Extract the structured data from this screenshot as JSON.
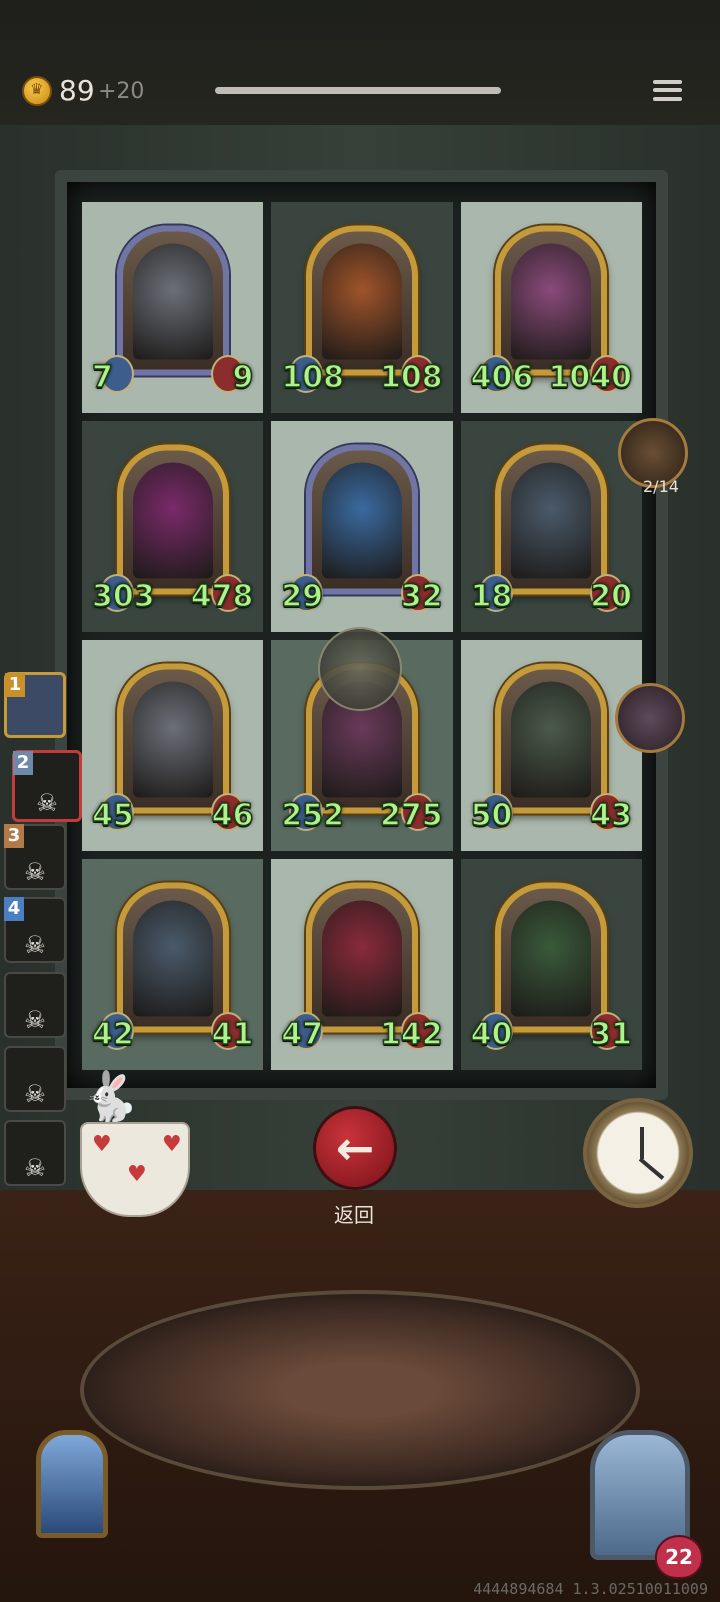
{
  "header": {
    "gold": "89",
    "gold_increment": "+20"
  },
  "board": {
    "rows": [
      [
        {
          "name": "gray-dragon",
          "atk": "7",
          "hp": "9",
          "style": "light",
          "frame": "blue",
          "color": "#6b6f78"
        },
        {
          "name": "orange-dragon",
          "atk": "108",
          "hp": "108",
          "style": "dark",
          "frame": "gold",
          "color": "#a0542a"
        },
        {
          "name": "monkey-king",
          "atk": "406",
          "hp": "1040",
          "style": "light",
          "frame": "gold",
          "color": "#8a4a7a"
        }
      ],
      [
        {
          "name": "red-haired-girl",
          "atk": "303",
          "hp": "478",
          "style": "dark",
          "frame": "gold",
          "color": "#7a2a6a"
        },
        {
          "name": "blue-elf",
          "atk": "29",
          "hp": "32",
          "style": "light",
          "frame": "blue",
          "color": "#3a6aa0"
        },
        {
          "name": "bat-beast",
          "atk": "18",
          "hp": "20",
          "style": "dark",
          "frame": "gold",
          "color": "#4a5a6a"
        }
      ],
      [
        {
          "name": "gray-dragon-2",
          "atk": "45",
          "hp": "46",
          "style": "light",
          "frame": "gold",
          "color": "#6b6f78"
        },
        {
          "name": "fire-rat",
          "atk": "252",
          "hp": "275",
          "style": "mid",
          "frame": "gold",
          "color": "#6a3a5a"
        },
        {
          "name": "hooded-reaper",
          "atk": "50",
          "hp": "43",
          "style": "light",
          "frame": "gold",
          "color": "#4a5a4a"
        }
      ],
      [
        {
          "name": "bat-beast-2",
          "atk": "42",
          "hp": "41",
          "style": "mid",
          "frame": "gold",
          "color": "#4a5a6a"
        },
        {
          "name": "clown",
          "atk": "47",
          "hp": "142",
          "style": "light",
          "frame": "gold",
          "color": "#8a2a3a"
        },
        {
          "name": "dragon-beast",
          "atk": "40",
          "hp": "31",
          "style": "dark",
          "frame": "gold",
          "color": "#3a5a3a"
        }
      ]
    ]
  },
  "side": {
    "turn_counter": "2/14"
  },
  "queue": {
    "items": [
      {
        "num": "1",
        "type": "gold"
      },
      {
        "num": "2",
        "type": "active"
      },
      {
        "num": "3",
        "type": "dead"
      },
      {
        "num": "4",
        "type": "dead"
      },
      {
        "num": "",
        "type": "dead"
      },
      {
        "num": "",
        "type": "dead"
      },
      {
        "num": "",
        "type": "dead"
      },
      {
        "num": "",
        "type": "dead"
      }
    ]
  },
  "back": {
    "label": "返回"
  },
  "hero": {
    "hp": "22"
  },
  "footer": {
    "build": "4444894684 1.3.02510011009"
  }
}
